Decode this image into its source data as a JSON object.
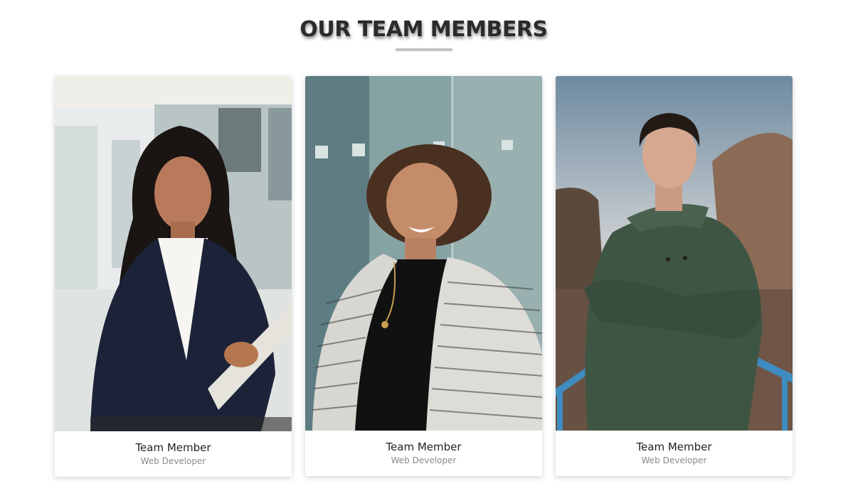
{
  "section": {
    "title": "OUR TEAM MEMBERS"
  },
  "team": [
    {
      "name": "Team Member",
      "role": "Web Developer",
      "photo": "woman-in-navy-blazer-holding-folder"
    },
    {
      "name": "Team Member",
      "role": "Web Developer",
      "photo": "curly-haired-woman-in-striped-jacket"
    },
    {
      "name": "Team Member",
      "role": "Web Developer",
      "photo": "young-man-in-green-hoodie-arms-crossed"
    }
  ],
  "colors": {
    "heading": "#2b2b2b",
    "underline": "#c2c2c2",
    "role_text": "#8a8a8a"
  }
}
